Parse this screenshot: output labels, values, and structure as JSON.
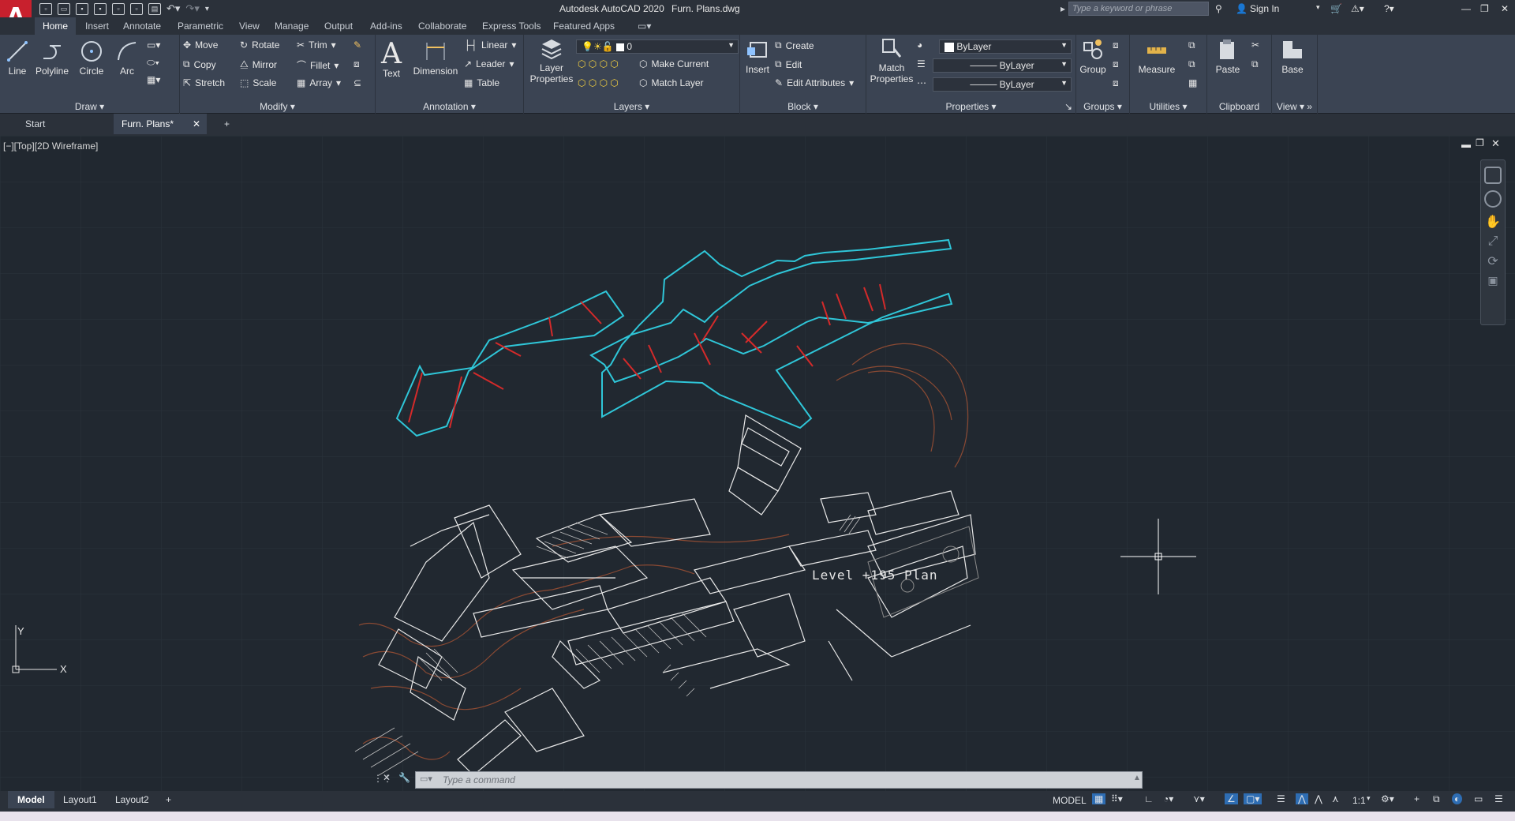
{
  "app": {
    "title": "Autodesk AutoCAD 2020",
    "file": "Furn. Plans.dwg",
    "logo": "A"
  },
  "search": {
    "placeholder": "Type a keyword or phrase"
  },
  "account": {
    "sign_in": "Sign In"
  },
  "ribbon_tabs": [
    "Home",
    "Insert",
    "Annotate",
    "Parametric",
    "View",
    "Manage",
    "Output",
    "Add-ins",
    "Collaborate",
    "Express Tools",
    "Featured Apps"
  ],
  "draw": {
    "label": "Draw",
    "line": "Line",
    "polyline": "Polyline",
    "circle": "Circle",
    "arc": "Arc"
  },
  "modify": {
    "label": "Modify",
    "move": "Move",
    "rotate": "Rotate",
    "trim": "Trim",
    "copy": "Copy",
    "mirror": "Mirror",
    "fillet": "Fillet",
    "stretch": "Stretch",
    "scale": "Scale",
    "array": "Array"
  },
  "annotation": {
    "label": "Annotation",
    "text": "Text",
    "dimension": "Dimension",
    "linear": "Linear",
    "leader": "Leader",
    "table": "Table"
  },
  "layers": {
    "label": "Layers",
    "layer_properties": "Layer Properties",
    "current_layer": "0",
    "make_current": "Make Current",
    "match_layer": "Match Layer"
  },
  "block": {
    "label": "Block",
    "insert": "Insert",
    "create": "Create",
    "edit": "Edit",
    "edit_attributes": "Edit Attributes"
  },
  "properties": {
    "label": "Properties",
    "match_properties": "Match Properties",
    "color": "ByLayer",
    "linetype": "ByLayer",
    "lineweight": "ByLayer"
  },
  "groups": {
    "label": "Groups",
    "group": "Group"
  },
  "utilities": {
    "label": "Utilities",
    "measure": "Measure"
  },
  "clipboard": {
    "label": "Clipboard",
    "paste": "Paste"
  },
  "view": {
    "label": "View",
    "base": "Base"
  },
  "doc_tabs": {
    "start": "Start",
    "current": "Furn. Plans*",
    "close": "✕",
    "add": "+"
  },
  "viewport": {
    "label": "[−][Top][2D Wireframe]",
    "drawing_title": "Level +195 Plan",
    "axis_y": "Y",
    "axis_x": "X"
  },
  "command": {
    "placeholder": "Type a command"
  },
  "layout_tabs": {
    "model": "Model",
    "layout1": "Layout1",
    "layout2": "Layout2",
    "add": "+"
  },
  "status": {
    "model": "MODEL",
    "scale": "1:1"
  },
  "colors": {
    "canvas": "#212830",
    "cyan": "#2fc6d8",
    "red": "#d42a2a",
    "brown": "#8b4a33",
    "ribbon": "#3b4453"
  }
}
